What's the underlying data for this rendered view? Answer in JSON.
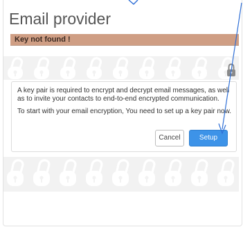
{
  "panel": {
    "title": "Email provider",
    "banner": "Key not found !"
  },
  "message": {
    "paragraph1": "A key pair is required to encrypt and decrypt email messages, as well as to invite your contacts to end-to-end encrypted communication.",
    "paragraph2": "To start with your email encryption, You need to set up a key pair now."
  },
  "buttons": {
    "cancel_label": "Cancel",
    "setup_label": "Setup"
  },
  "icons": {
    "background_pattern": "padlock-pattern-icon",
    "lock": "lock-icon"
  },
  "colors": {
    "banner_bg": "#cf9e84",
    "primary_button": "#3d93e8",
    "annotation_arrow": "#2f6fd6"
  }
}
